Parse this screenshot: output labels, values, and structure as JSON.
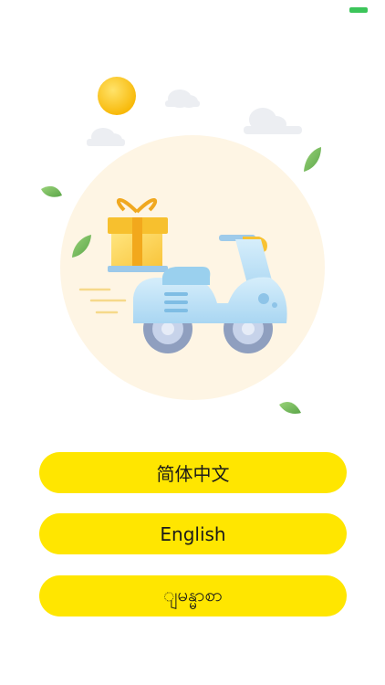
{
  "status_bar": {
    "battery_icon": "battery-icon",
    "battery_color": "#3cc55a"
  },
  "illustration": {
    "icons": [
      "sun-icon",
      "cloud-icon",
      "leaf-icon",
      "gift-box-icon",
      "delivery-scooter-icon",
      "speed-lines-icon"
    ]
  },
  "language_options": [
    {
      "label": "简体中文"
    },
    {
      "label": "English"
    },
    {
      "label": "ျမန္မာစာ"
    }
  ],
  "theme": {
    "button_color": "#ffe600",
    "circle_color": "#fef5e4"
  }
}
